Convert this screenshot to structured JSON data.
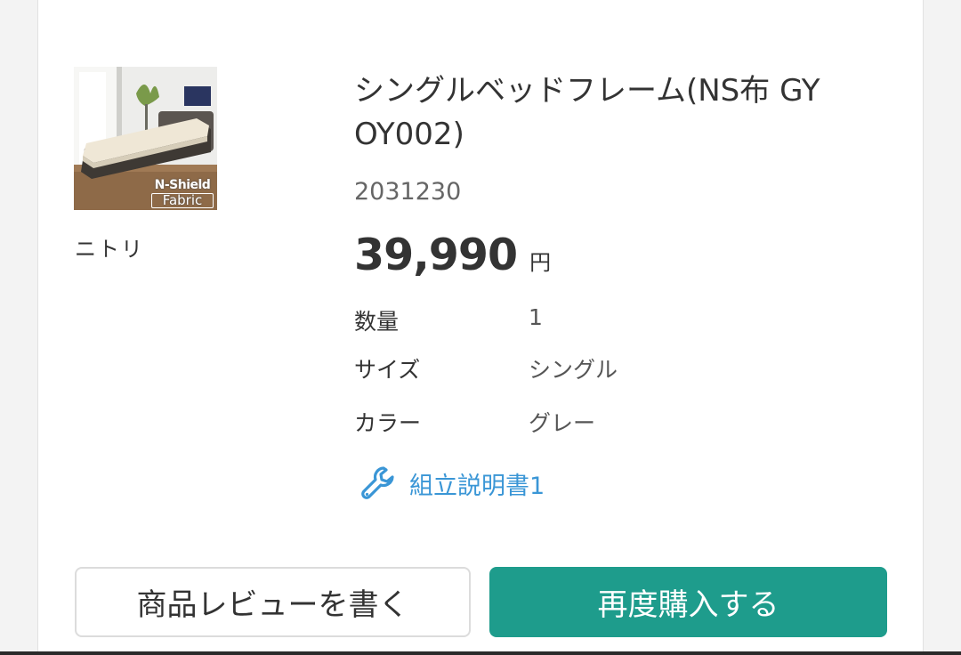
{
  "product": {
    "image_badge_top": "N-Shield",
    "image_badge_bottom": "Fabric",
    "brand": "ニトリ",
    "title": "シングルベッドフレーム(NS布 GY OY002)",
    "sku": "2031230",
    "price": "39,990",
    "currency": "円",
    "specs": [
      {
        "label": "数量",
        "value": "1"
      },
      {
        "label": "サイズ",
        "value": "シングル"
      },
      {
        "label": "カラー",
        "value": "グレー"
      }
    ],
    "manual_link": "組立説明書1"
  },
  "actions": {
    "review_label": "商品レビューを書く",
    "rebuy_label": "再度購入する"
  },
  "colors": {
    "accent": "#1e9c8c",
    "link": "#3a96d6"
  },
  "icons": {
    "manual": "wrench-icon"
  }
}
